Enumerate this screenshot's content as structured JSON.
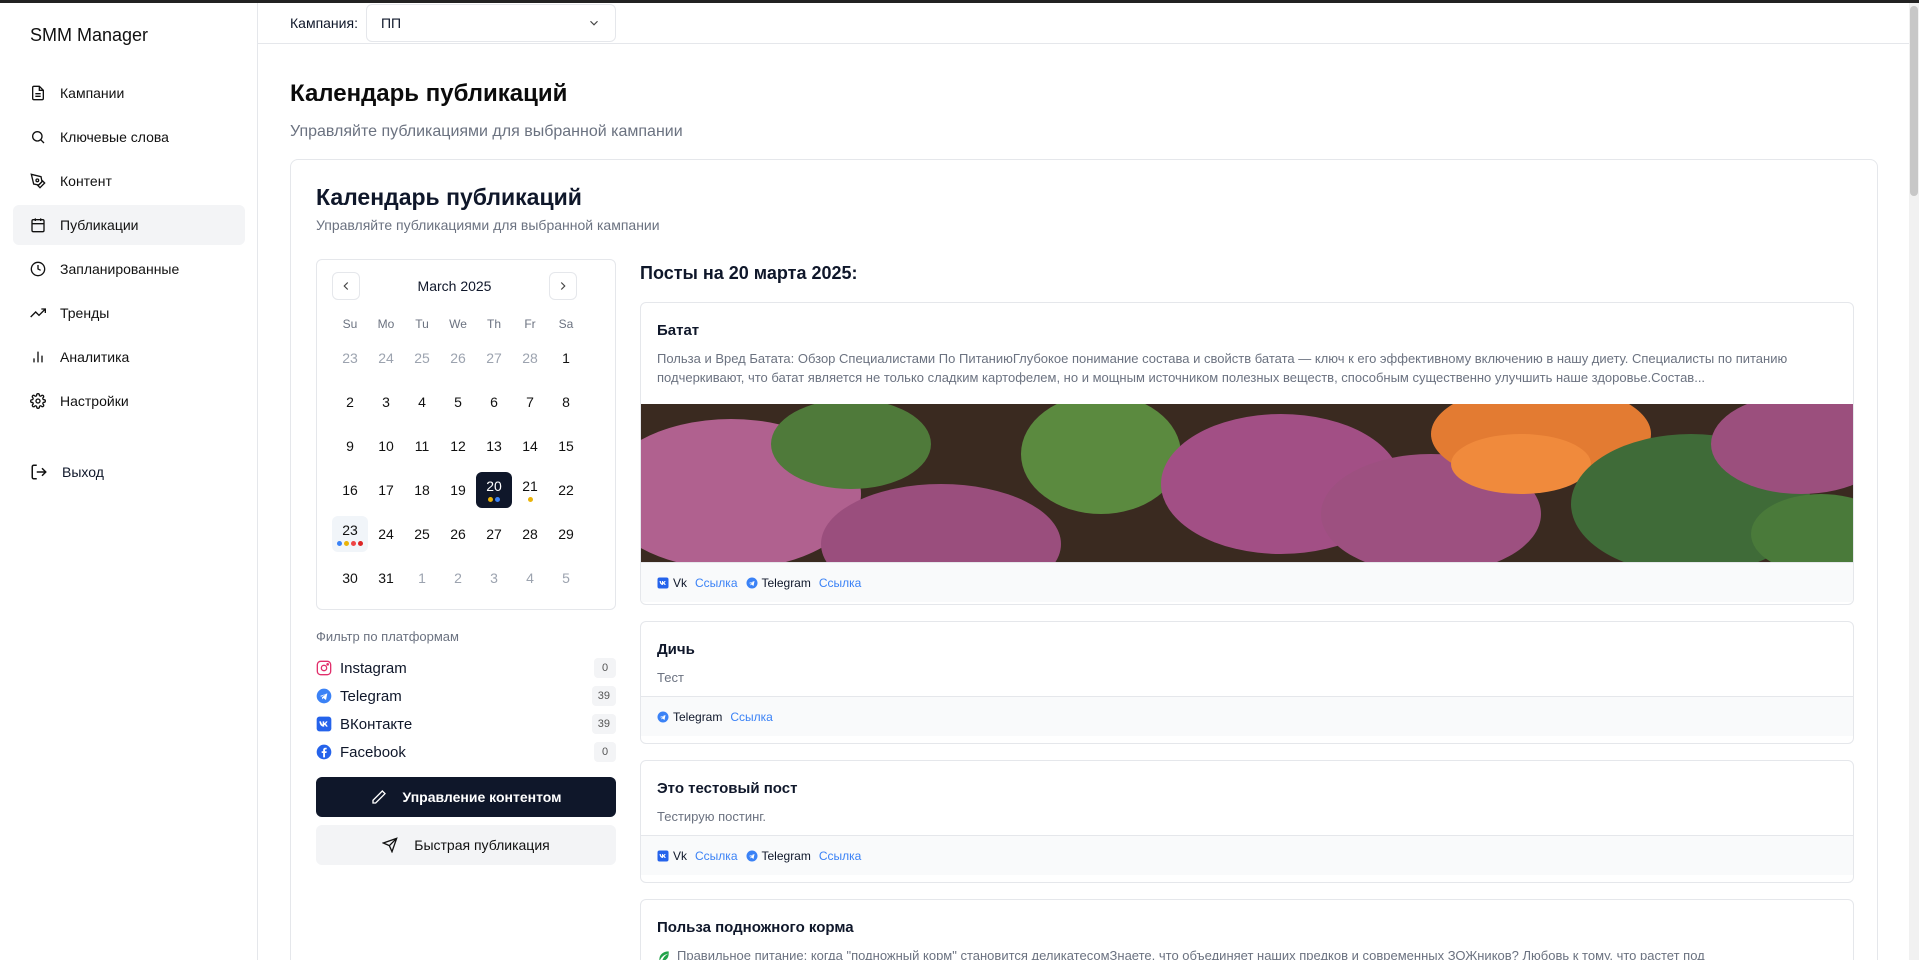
{
  "app": {
    "title": "SMM Manager"
  },
  "sidebar": {
    "items": [
      {
        "label": "Кампании",
        "icon": "file-icon"
      },
      {
        "label": "Ключевые слова",
        "icon": "search-icon"
      },
      {
        "label": "Контент",
        "icon": "pen-tool-icon"
      },
      {
        "label": "Публикации",
        "icon": "calendar-icon",
        "active": true
      },
      {
        "label": "Запланированные",
        "icon": "clock-icon"
      },
      {
        "label": "Тренды",
        "icon": "trending-up-icon"
      },
      {
        "label": "Аналитика",
        "icon": "bar-chart-icon"
      },
      {
        "label": "Настройки",
        "icon": "gear-icon"
      }
    ],
    "logout": "Выход"
  },
  "topbar": {
    "campaign_label": "Кампания:",
    "campaign_value": "ПП"
  },
  "page": {
    "title": "Календарь публикаций",
    "subtitle": "Управляйте публикациями для выбранной кампании"
  },
  "card": {
    "title": "Календарь публикаций",
    "subtitle": "Управляйте публикациями для выбранной кампании"
  },
  "calendar": {
    "month": "March 2025",
    "weekdays": [
      "Su",
      "Mo",
      "Tu",
      "We",
      "Th",
      "Fr",
      "Sa"
    ],
    "weeks": [
      [
        "23",
        "24",
        "25",
        "26",
        "27",
        "28",
        "1"
      ],
      [
        "2",
        "3",
        "4",
        "5",
        "6",
        "7",
        "8"
      ],
      [
        "9",
        "10",
        "11",
        "12",
        "13",
        "14",
        "15"
      ],
      [
        "16",
        "17",
        "18",
        "19",
        "20",
        "21",
        "22"
      ],
      [
        "23",
        "24",
        "25",
        "26",
        "27",
        "28",
        "29"
      ],
      [
        "30",
        "31",
        "1",
        "2",
        "3",
        "4",
        "5"
      ]
    ],
    "selected": "20",
    "today": "23"
  },
  "filter": {
    "title": "Фильтр по платформам",
    "items": [
      {
        "label": "Instagram",
        "count": "0",
        "icon": "instagram-icon",
        "color": "#e1306c"
      },
      {
        "label": "Telegram",
        "count": "39",
        "icon": "telegram-icon",
        "color": "#3b82f6"
      },
      {
        "label": "ВКонтакте",
        "count": "39",
        "icon": "vk-icon",
        "color": "#2563eb"
      },
      {
        "label": "Facebook",
        "count": "0",
        "icon": "facebook-icon",
        "color": "#2563eb"
      }
    ]
  },
  "buttons": {
    "manage": "Управление контентом",
    "quick": "Быстрая публикация"
  },
  "posts": {
    "heading": "Посты на 20 марта 2025:",
    "items": [
      {
        "title": "Батат",
        "body": "Польза и Вред Батата: Обзор Специалистами По ПитаниюГлубокое понимание состава и свойств батата — ключ к его эффективному включению в нашу диету. Специалисты по питанию подчеркивают, что батат является не только сладким картофелем, но и мощным источником полезных веществ, способным существенно улучшить наше здоровье.Состав...",
        "platforms": [
          {
            "name": "Vk",
            "link": "Ссылка"
          },
          {
            "name": "Telegram",
            "link": "Ссылка"
          }
        ]
      },
      {
        "title": "Дичь",
        "body": "Тест",
        "platforms": [
          {
            "name": "Telegram",
            "link": "Ссылка"
          }
        ]
      },
      {
        "title": "Это тестовый пост",
        "body": "Тестирую постинг.",
        "platforms": [
          {
            "name": "Vk",
            "link": "Ссылка"
          },
          {
            "name": "Telegram",
            "link": "Ссылка"
          }
        ]
      },
      {
        "title": "Польза подножного корма",
        "body": "Правильное питание: когда \"подножный корм\" становится деликатесомЗнаете, что объединяет наших предков и современных ЗОЖников? Любовь к тому, что растет под"
      }
    ]
  },
  "colors": {
    "accent": "#0f172a",
    "link": "#3b82f6",
    "muted": "#6b7280"
  }
}
